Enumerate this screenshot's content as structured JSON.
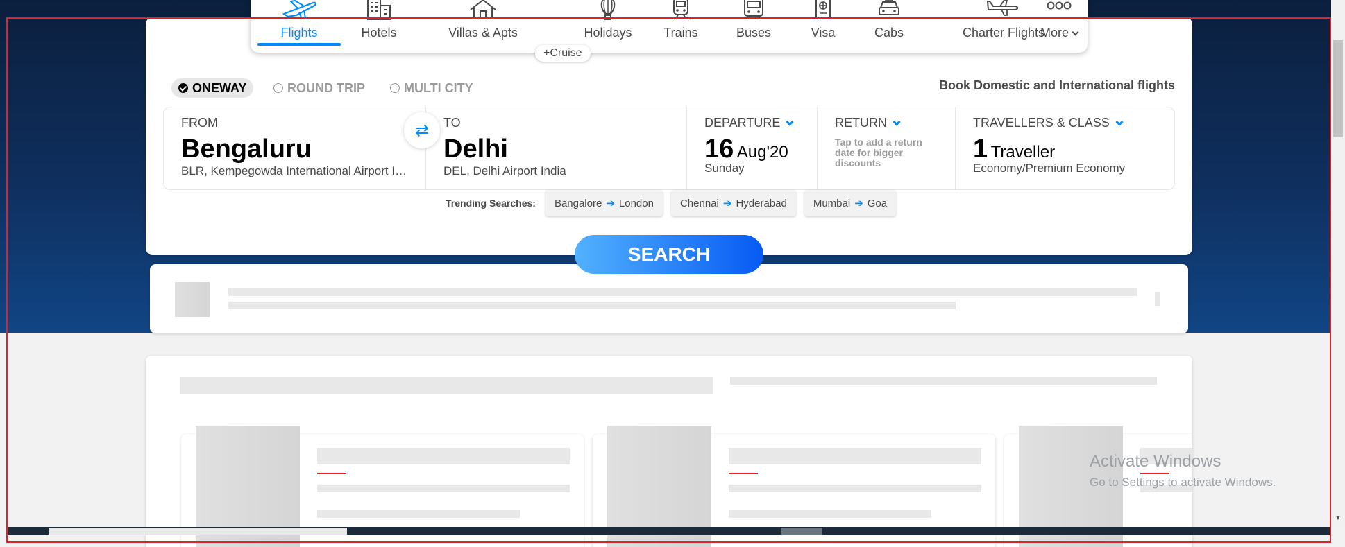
{
  "nav": {
    "items": [
      {
        "label": "Flights",
        "icon": "plane-icon",
        "active": true
      },
      {
        "label": "Hotels",
        "icon": "building-icon"
      },
      {
        "label": "Villas & Apts",
        "icon": "house-icon"
      },
      {
        "label": "Holidays",
        "icon": "balloon-icon"
      },
      {
        "label": "Trains",
        "icon": "train-icon"
      },
      {
        "label": "Buses",
        "icon": "bus-icon"
      },
      {
        "label": "Visa",
        "icon": "passport-icon"
      },
      {
        "label": "Cabs",
        "icon": "taxi-icon"
      },
      {
        "label": "Charter Flights",
        "icon": "jet-icon"
      },
      {
        "label": "More",
        "icon": "more-dots-icon"
      }
    ],
    "cruise_tag": "+Cruise"
  },
  "trip": {
    "oneway": "ONEWAY",
    "roundtrip": "ROUND TRIP",
    "multicity": "MULTI CITY",
    "book_text": "Book Domestic and International flights"
  },
  "from": {
    "label": "FROM",
    "city": "Bengaluru",
    "airport": "BLR, Kempegowda International Airport India"
  },
  "to": {
    "label": "TO",
    "city": "Delhi",
    "airport": "DEL, Delhi Airport India"
  },
  "departure": {
    "label": "DEPARTURE",
    "day": "16",
    "month": "Aug'20",
    "weekday": "Sunday"
  },
  "return": {
    "label": "RETURN",
    "hint": "Tap to add a return date for bigger discounts"
  },
  "travellers": {
    "label": "TRAVELLERS & CLASS",
    "count": "1",
    "unit": "Traveller",
    "class": "Economy/Premium Economy"
  },
  "trending": {
    "label": "Trending Searches:",
    "items": [
      {
        "from": "Bangalore",
        "to": "London"
      },
      {
        "from": "Chennai",
        "to": "Hyderabad"
      },
      {
        "from": "Mumbai",
        "to": "Goa"
      }
    ]
  },
  "search_label": "SEARCH",
  "watermark": {
    "title": "Activate Windows",
    "subtitle": "Go to Settings to activate Windows."
  },
  "colors": {
    "accent": "#008cff",
    "dark_bg": "#0f2f5e"
  }
}
